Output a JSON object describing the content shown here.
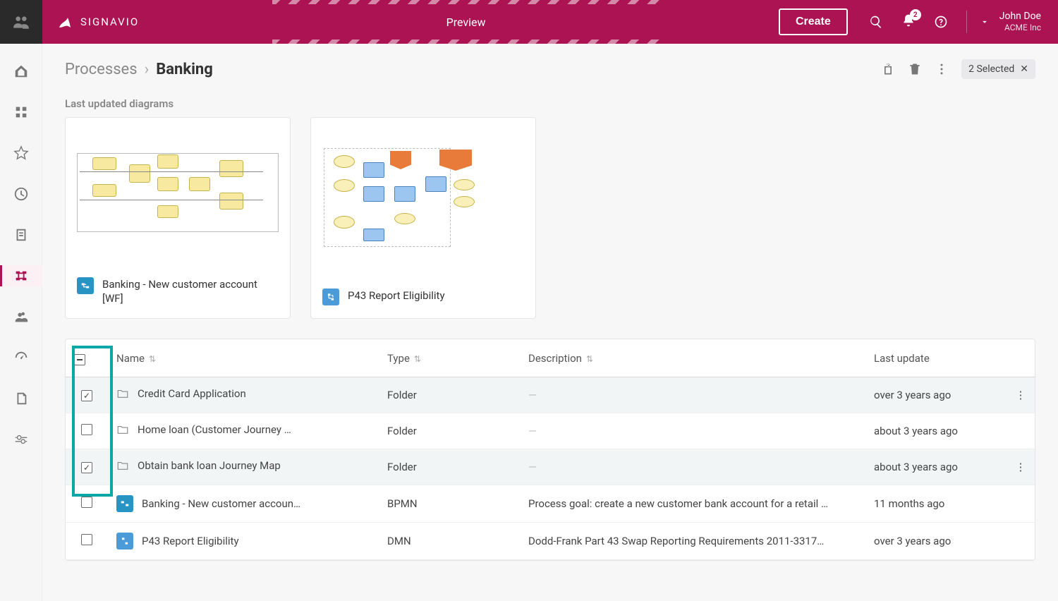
{
  "brand": "SIGNAVIO",
  "preview_label": "Preview",
  "create_label": "Create",
  "notification_count": "2",
  "user": {
    "name": "John Doe",
    "org": "ACME Inc"
  },
  "breadcrumb": {
    "root": "Processes",
    "current": "Banking"
  },
  "selection_pill": "2 Selected",
  "section_label": "Last updated diagrams",
  "cards": [
    {
      "title": "Banking - New customer account [WF]",
      "type": "bpmn"
    },
    {
      "title": "P43 Report Eligibility",
      "type": "dmn"
    }
  ],
  "columns": {
    "name": "Name",
    "type": "Type",
    "description": "Description",
    "last_update": "Last update"
  },
  "rows": [
    {
      "selected": true,
      "icon": "folder",
      "name": "Credit Card Application",
      "type": "Folder",
      "description": "—",
      "last_update": "over 3 years ago"
    },
    {
      "selected": false,
      "icon": "folder",
      "name": "Home loan (Customer Journey …",
      "type": "Folder",
      "description": "—",
      "last_update": "about 3 years ago"
    },
    {
      "selected": true,
      "icon": "folder",
      "name": "Obtain bank loan Journey Map",
      "type": "Folder",
      "description": "—",
      "last_update": "about 3 years ago"
    },
    {
      "selected": false,
      "icon": "bpmn",
      "name": "Banking - New customer accoun…",
      "type": "BPMN",
      "description": "Process goal: create a new customer bank account for a retail …",
      "last_update": "11 months ago"
    },
    {
      "selected": false,
      "icon": "dmn",
      "name": "P43 Report Eligibility",
      "type": "DMN",
      "description": "Dodd-Frank Part 43 Swap Reporting Requirements 2011-3317…",
      "last_update": "over 3 years ago"
    }
  ]
}
